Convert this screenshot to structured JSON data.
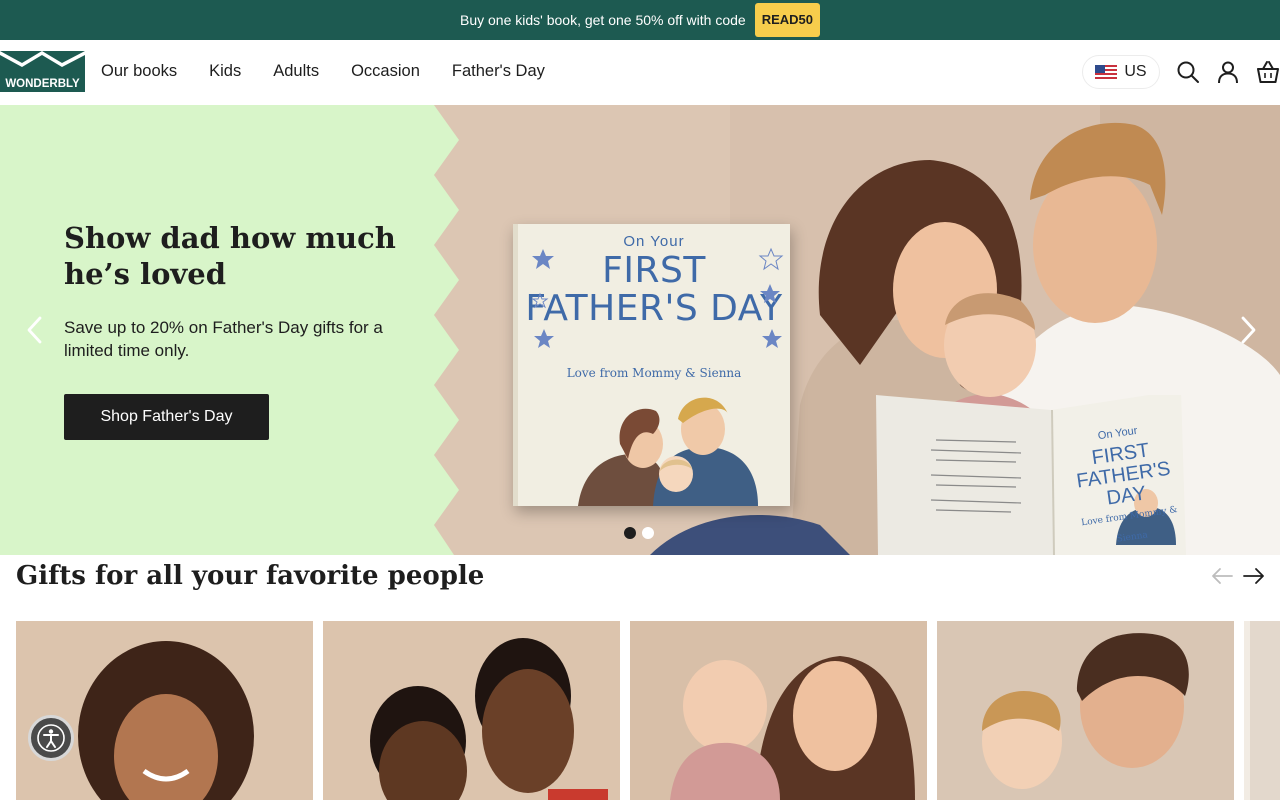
{
  "promo": {
    "text": "Buy one kids' book, get one 50% off with code",
    "code": "READ50"
  },
  "header": {
    "logo_text": "WONDERBLY",
    "nav": [
      "Our books",
      "Kids",
      "Adults",
      "Occasion",
      "Father's Day"
    ],
    "locale": "US",
    "icons": [
      "search-icon",
      "account-icon",
      "basket-icon"
    ]
  },
  "hero": {
    "title": "Show dad how much he’s loved",
    "subtitle": "Save up to 20% on Father's Day gifts for a limited time only.",
    "cta": "Shop Father's Day",
    "book_cover": {
      "small": "On Your",
      "big": "FIRST FATHER'S DAY",
      "love": "Love from Mommy & Sienna"
    },
    "open_book": {
      "small": "On Your",
      "big": "FIRST FATHER'S DAY",
      "love": "Love from Mommy & Sienna"
    },
    "slides": 2,
    "active_slide": 1
  },
  "section": {
    "title": "Gifts for all your favorite people"
  },
  "colors": {
    "promo_bg": "#1d5a51",
    "promo_code_bg": "#f7cd4c",
    "hero_panel": "#d8f5c9",
    "cta_bg": "#1e1e1e",
    "book_blue": "#3f6aa8"
  }
}
